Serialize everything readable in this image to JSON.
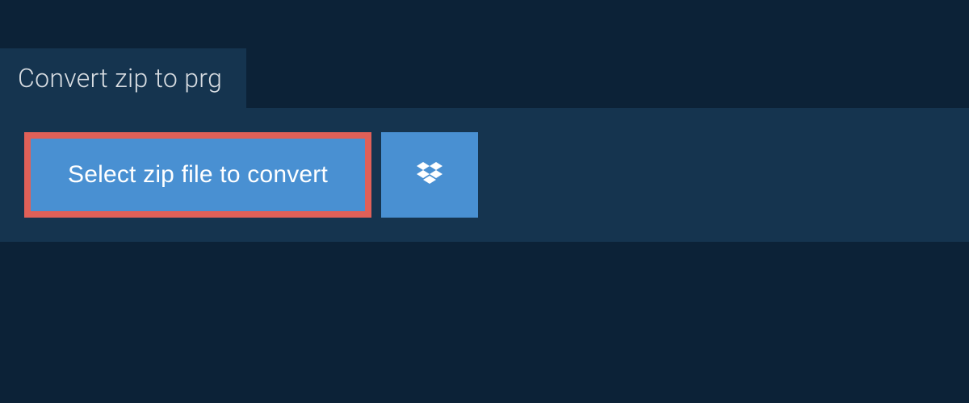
{
  "header": {
    "title": "Convert zip to prg"
  },
  "actions": {
    "select_label": "Select zip file to convert",
    "dropbox_icon_name": "dropbox"
  },
  "colors": {
    "page_bg": "#0c2237",
    "panel_bg": "#15344f",
    "button_bg": "#4990d2",
    "highlight_border": "#e06058",
    "text_light": "#d8dde2",
    "text_white": "#ffffff"
  }
}
